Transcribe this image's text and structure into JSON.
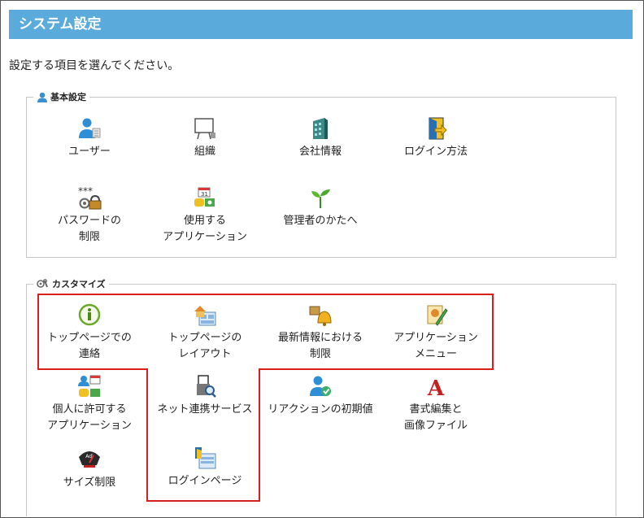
{
  "header": {
    "title": "システム設定"
  },
  "instruction": "設定する項目を選んでください。",
  "basic": {
    "legend": "基本設定",
    "items": [
      {
        "label": "ユーザー"
      },
      {
        "label": "組織"
      },
      {
        "label": "会社情報"
      },
      {
        "label": "ログイン方法"
      },
      {
        "label": "パスワードの\n制限"
      },
      {
        "label": "使用する\nアプリケーション"
      },
      {
        "label": "管理者のかたへ"
      }
    ]
  },
  "custom": {
    "legend": "カスタマイズ",
    "items": [
      {
        "label": "トップページでの\n連絡"
      },
      {
        "label": "トップページの\nレイアウト"
      },
      {
        "label": "最新情報における\n制限"
      },
      {
        "label": "アプリケーション\nメニュー"
      },
      {
        "label": "個人に許可する\nアプリケーション"
      },
      {
        "label": "ネット連携サービス"
      },
      {
        "label": "リアクションの初期値"
      },
      {
        "label": "書式編集と\n画像ファイル"
      },
      {
        "label": "サイズ制限"
      },
      {
        "label": "ログインページ"
      }
    ]
  },
  "icons": {
    "password_stars": "***",
    "calendar_num": "31",
    "font_letter": "A",
    "gauge_text": "Adj"
  },
  "colors": {
    "header_bg": "#5aabdc",
    "highlight": "#d81e1e"
  }
}
